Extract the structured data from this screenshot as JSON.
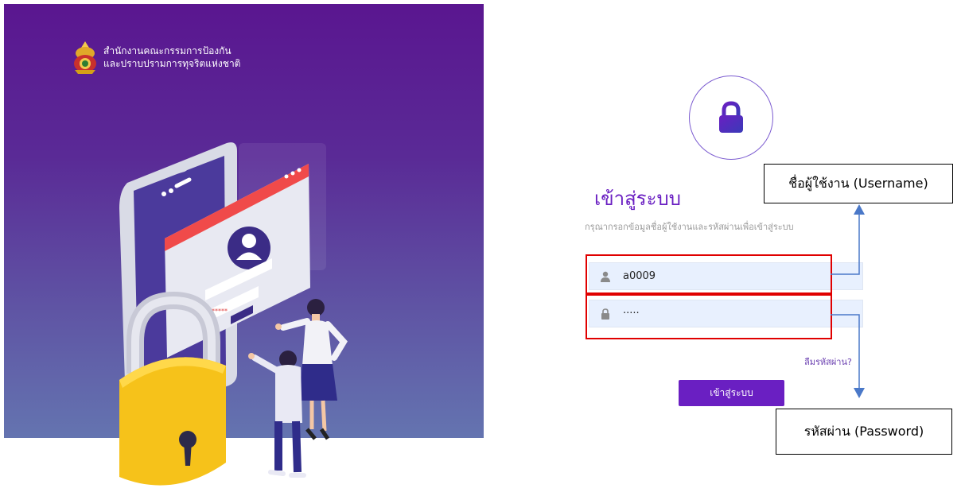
{
  "organization": {
    "name_line1": "สำนักงานคณะกรรมการป้องกัน",
    "name_line2": "และปราบปรามการทุจริตแห่งชาติ"
  },
  "login": {
    "title": "เข้าสู่ระบบ",
    "subtitle": "กรุณากรอกข้อมูลชื่อผู้ใช้งานและรหัสผ่านเพื่อเข้าสู่ระบบ",
    "username_value": "a0009",
    "password_value": "·····",
    "forgot_label": "ลืมรหัสผ่าน?",
    "submit_label": "เข้าสู่ระบบ"
  },
  "annotations": {
    "username_label": "ชื่อผู้ใช้งาน (Username)",
    "password_label": "รหัสผ่าน (Password)"
  },
  "illustration": {
    "password_mask": "*****"
  },
  "colors": {
    "accent": "#6a1fc2",
    "highlight": "#e00000",
    "arrow": "#4a78c8",
    "field_bg": "#e8f0fe"
  }
}
